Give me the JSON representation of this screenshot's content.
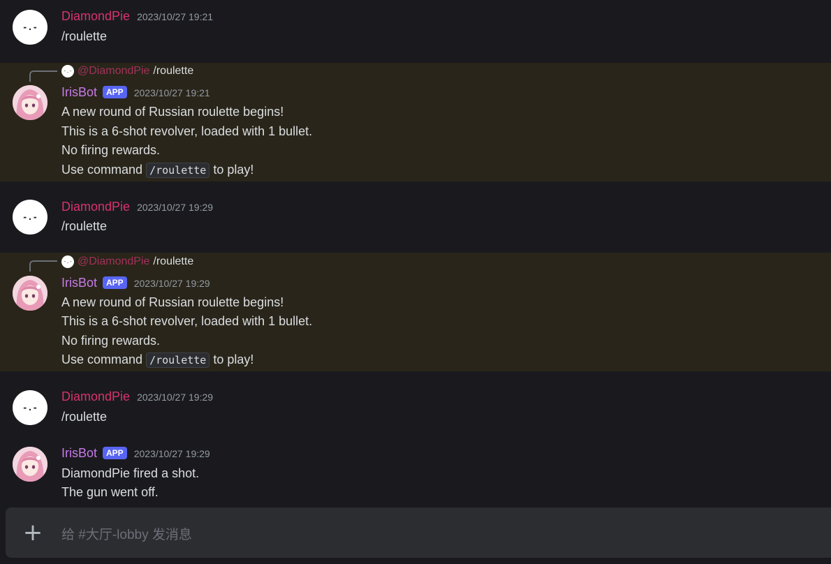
{
  "users": {
    "pie": {
      "name": "DiamondPie",
      "avatar_face": "-.-"
    },
    "bot": {
      "name": "IrisBot",
      "badge": "APP"
    }
  },
  "reply": {
    "mention": "@DiamondPie",
    "text": "/roulette",
    "mini_face": "-.-"
  },
  "messages": [
    {
      "time": "2023/10/27 19:21",
      "text": "/roulette"
    },
    {
      "time": "2023/10/27 19:21",
      "lines": [
        "A new round of Russian roulette begins!",
        "This is a 6-shot revolver, loaded with 1 bullet.",
        "No firing rewards."
      ],
      "cmd_prefix": "Use command",
      "cmd": "/roulette",
      "cmd_suffix": "to play!"
    },
    {
      "time": "2023/10/27 19:29",
      "text": "/roulette"
    },
    {
      "time": "2023/10/27 19:29",
      "lines": [
        "A new round of Russian roulette begins!",
        "This is a 6-shot revolver, loaded with 1 bullet.",
        "No firing rewards."
      ],
      "cmd_prefix": "Use command",
      "cmd": "/roulette",
      "cmd_suffix": "to play!"
    },
    {
      "time": "2023/10/27 19:29",
      "text": "/roulette"
    },
    {
      "time": "2023/10/27 19:29",
      "lines": [
        "DiamondPie fired a shot.",
        "The gun went off."
      ]
    }
  ],
  "composer": {
    "placeholder": "给 #大厅-lobby 发消息",
    "add_icon": "plus-icon",
    "add_glyph": "+"
  },
  "colors": {
    "background": "#1a1a1e",
    "highlight": "#29251a",
    "pie_name": "#d8336c",
    "bot_name": "#c77ae8",
    "badge": "#5865f2"
  }
}
